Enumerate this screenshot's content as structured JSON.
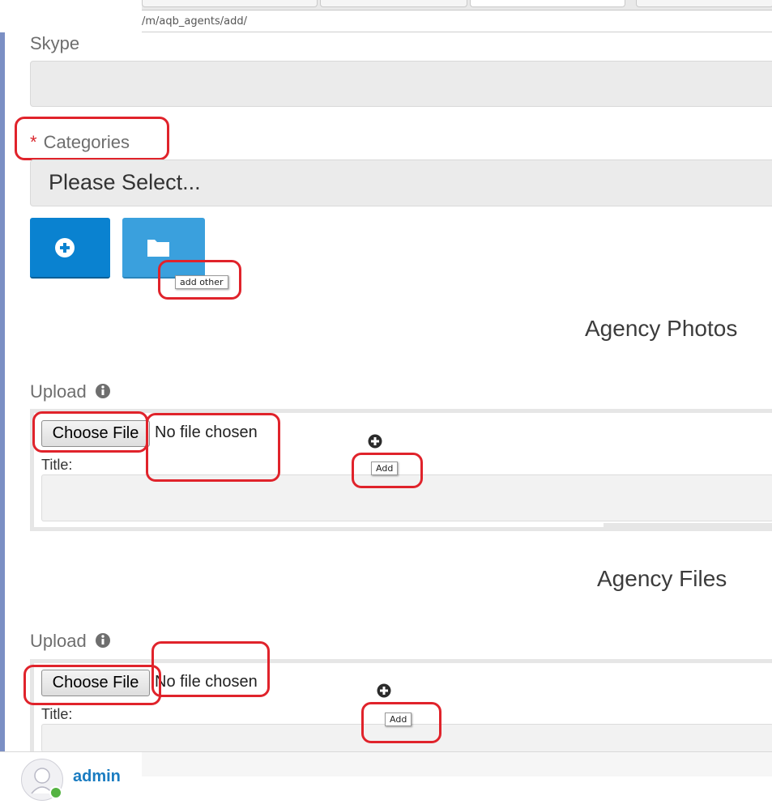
{
  "browser": {
    "url": "/m/aqb_agents/add/"
  },
  "form": {
    "skype_label": "Skype",
    "categories_required_mark": "*",
    "categories_label": "Categories",
    "categories_select_value": "Please Select...",
    "add_other_tooltip": "add other"
  },
  "photos": {
    "section_title": "Agency Photos",
    "upload_label": "Upload",
    "choose_file_label": "Choose File",
    "no_file_text": "No file chosen",
    "title_label": "Title:",
    "add_tooltip": "Add"
  },
  "files": {
    "section_title": "Agency Files",
    "upload_label": "Upload",
    "choose_file_label": "Choose File",
    "no_file_text": "No file chosen",
    "title_label": "Title:",
    "add_tooltip": "Add"
  },
  "footer": {
    "username": "admin"
  },
  "colors": {
    "primary_button": "#0a82d0",
    "secondary_button": "#3aa0dd",
    "annotation_red": "#e0232b",
    "link_blue": "#1a7cc1"
  },
  "icons": [
    "plus-circle-icon",
    "folder-icon",
    "info-icon"
  ]
}
